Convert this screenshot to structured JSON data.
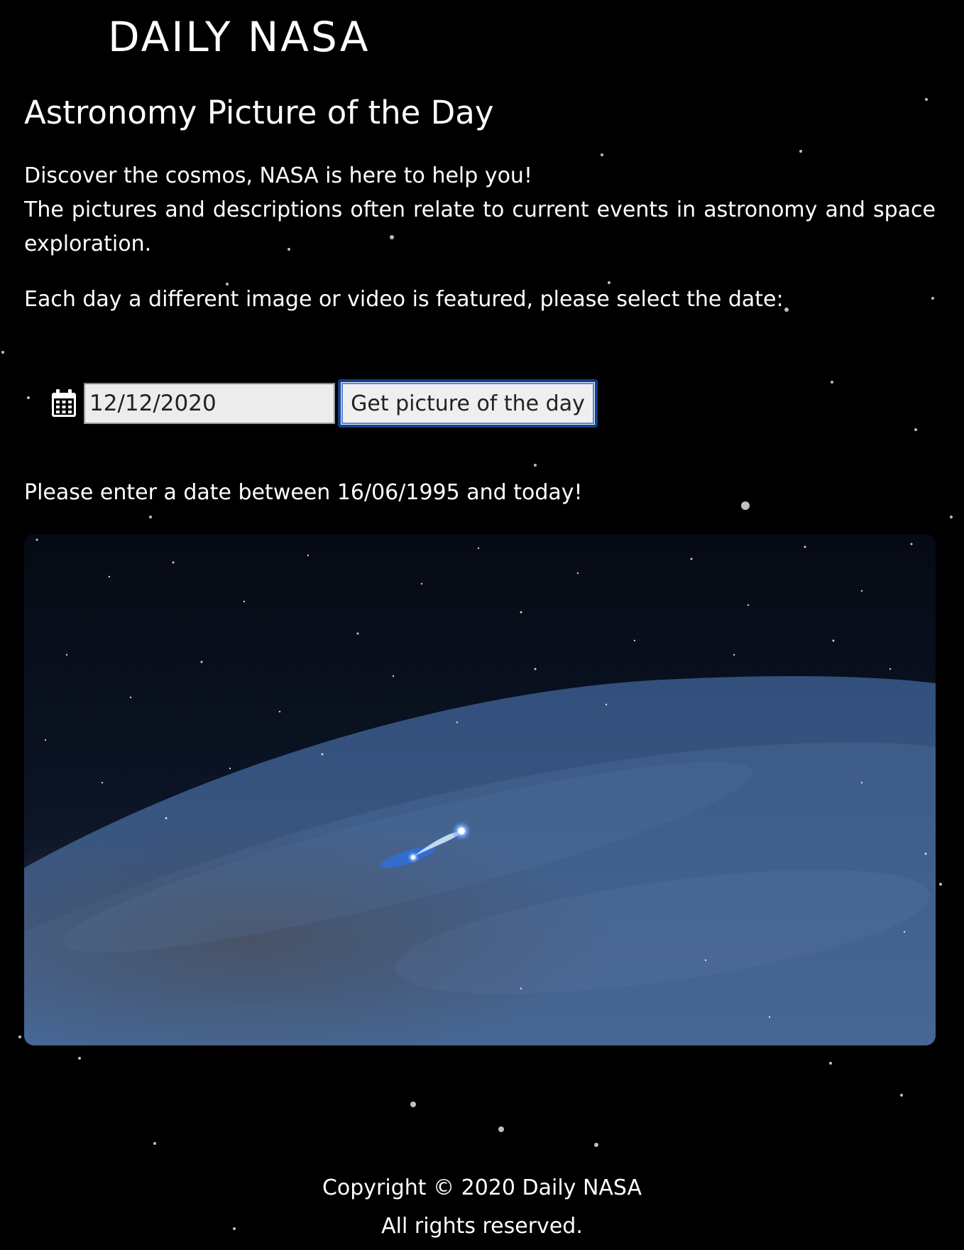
{
  "header": {
    "logo_text": "DAILY NASA"
  },
  "main": {
    "title": "Astronomy Picture of the Day",
    "intro_line1": "Discover the cosmos, NASA is here to help you!",
    "intro_line2": "The pictures and descriptions often relate to current events in astronomy and space exploration.",
    "select_prompt": "Each day a different image or video is featured, please select the date:",
    "date_value": "12/12/2020",
    "calendar_icon": "calendar-icon",
    "submit_label": "Get picture of the day",
    "hint": "Please enter a date between 16/06/1995 and today!",
    "picture": {
      "description": "Artist illustration of a bright blue comet-like object crossing a vast bluish dust disk against a starry black sky"
    }
  },
  "footer": {
    "copyright": "Copyright © 2020 Daily NASA",
    "rights": "All rights reserved."
  },
  "colors": {
    "background": "#000000",
    "text": "#ffffff",
    "button_border": "#0f3f8f",
    "input_background": "#ececec"
  }
}
